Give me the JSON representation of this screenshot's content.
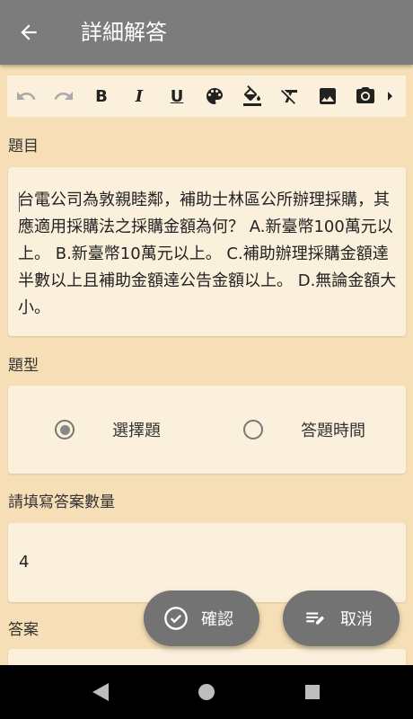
{
  "appbar": {
    "title": "詳細解答",
    "back_icon": "arrow-back-icon"
  },
  "toolbar": {
    "items": [
      "undo-icon",
      "redo-icon",
      "bold",
      "italic",
      "underline",
      "palette-icon",
      "fill-color-icon",
      "clear-format-icon",
      "image-icon",
      "camera-icon",
      "more-arrow-icon"
    ],
    "bold_label": "B",
    "italic_label": "I",
    "underline_label": "U"
  },
  "question": {
    "label": "題目",
    "text": "台電公司為敦親睦鄰，補助士林區公所辦理採購，其應適用採購法之採購金額為何？ A.新臺幣100萬元以上。 B.新臺幣10萬元以上。 C.補助辦理採購金額達半數以上且補助金額達公告金額以上。 D.無論金額大小。"
  },
  "question_type": {
    "label": "題型",
    "options": [
      {
        "label": "選擇題",
        "selected": true
      },
      {
        "label": "答題時間",
        "selected": false
      }
    ]
  },
  "answer_count": {
    "label": "請填寫答案數量",
    "value": "4"
  },
  "answer": {
    "label": "答案"
  },
  "fab": {
    "confirm_label": "確認",
    "cancel_label": "取消"
  },
  "colors": {
    "background": "#f6dfb6",
    "card": "#fbf0dc",
    "appbar": "#7c7c7c",
    "fab": "#737373"
  }
}
